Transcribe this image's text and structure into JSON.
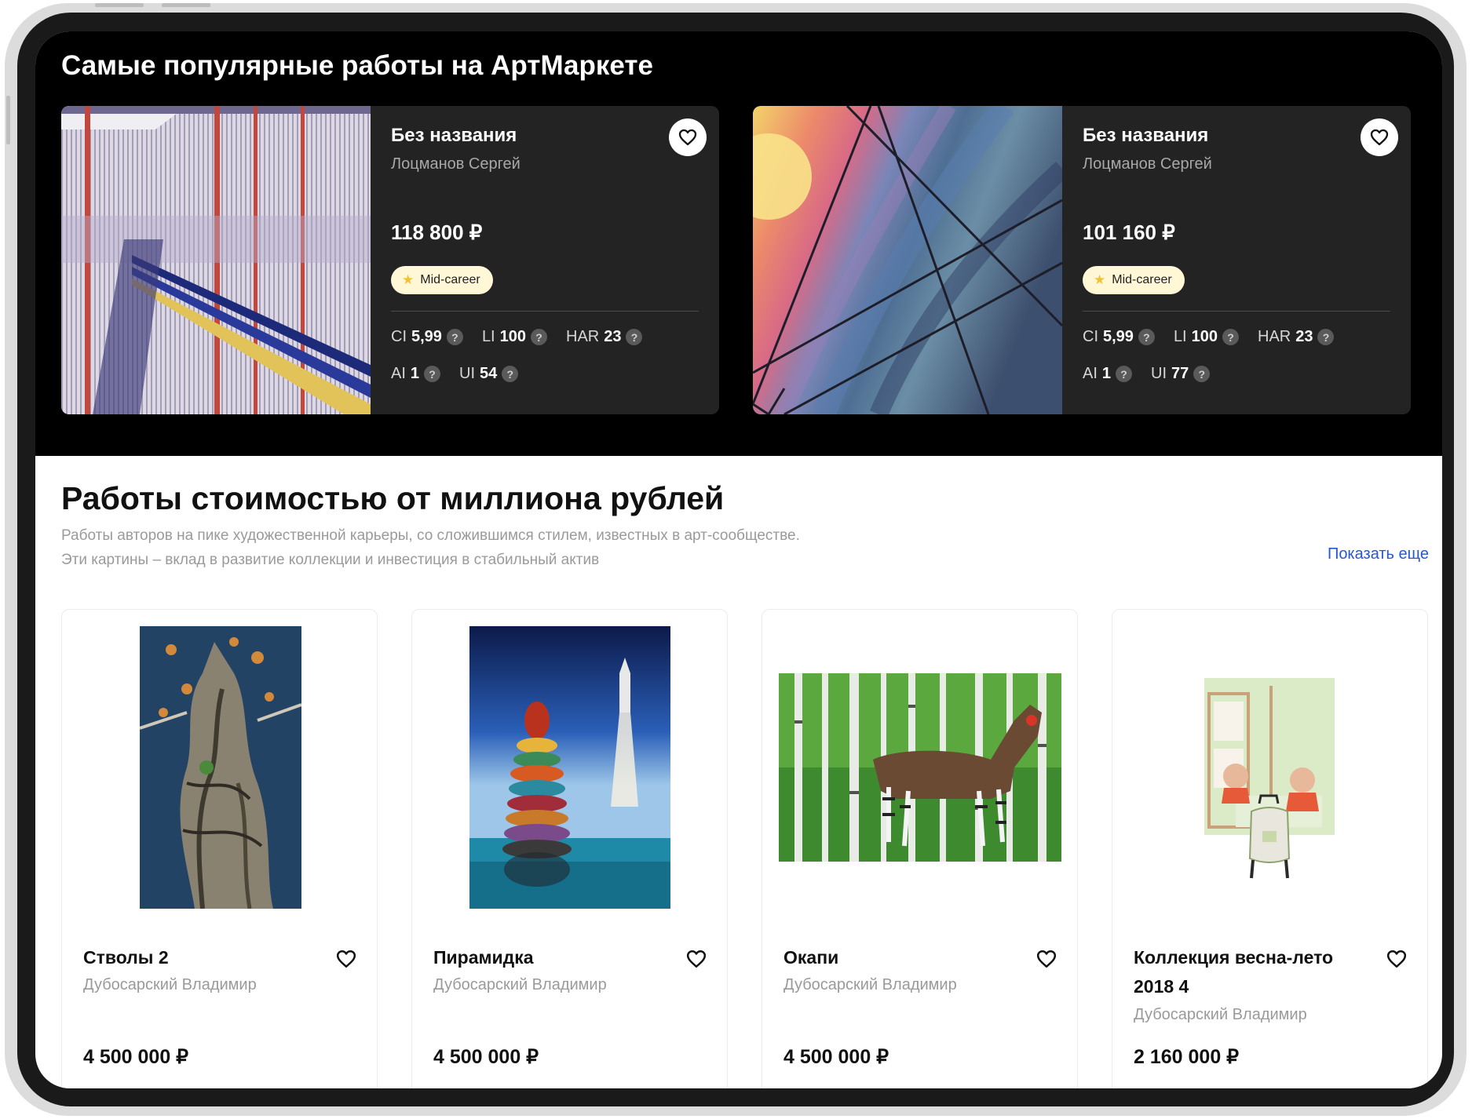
{
  "popular": {
    "title": "Самые популярные работы на АртМаркете",
    "cards": [
      {
        "title": "Без названия",
        "artist": "Лоцманов Сергей",
        "price": "118 800 ₽",
        "badge": "Mid-career",
        "metrics": [
          {
            "label": "CI",
            "value": "5,99"
          },
          {
            "label": "LI",
            "value": "100"
          },
          {
            "label": "HAR",
            "value": "23"
          },
          {
            "label": "AI",
            "value": "1"
          },
          {
            "label": "UI",
            "value": "54"
          }
        ]
      },
      {
        "title": "Без названия",
        "artist": "Лоцманов Сергей",
        "price": "101 160 ₽",
        "badge": "Mid-career",
        "metrics": [
          {
            "label": "CI",
            "value": "5,99"
          },
          {
            "label": "LI",
            "value": "100"
          },
          {
            "label": "HAR",
            "value": "23"
          },
          {
            "label": "AI",
            "value": "1"
          },
          {
            "label": "UI",
            "value": "77"
          }
        ]
      }
    ]
  },
  "million": {
    "title": "Работы стоимостью от миллиона рублей",
    "description_line1": "Работы авторов на пике художественной карьеры, со сложившимся стилем, известных в арт-сообществе.",
    "description_line2": "Эти картины – вклад в развитие коллекции и инвестиция в стабильный актив",
    "show_more": "Показать еще",
    "cards": [
      {
        "title": "Стволы 2",
        "artist": "Дубосарский Владимир",
        "price": "4 500 000 ₽"
      },
      {
        "title": "Пирамидка",
        "artist": "Дубосарский Владимир",
        "price": "4 500 000 ₽"
      },
      {
        "title": "Окапи",
        "artist": "Дубосарский Владимир",
        "price": "4 500 000 ₽"
      },
      {
        "title": "Коллекция весна-лето 2018 4",
        "artist": "Дубосарский Владимир",
        "price": "2 160 000 ₽"
      }
    ]
  },
  "icons": {
    "favorite": "heart-icon",
    "info": "question-icon",
    "badge": "star-icon"
  },
  "colors": {
    "link": "#2557d6",
    "badge_bg": "#fff7d6",
    "badge_star": "#f1c232",
    "card_dark": "#232323"
  }
}
